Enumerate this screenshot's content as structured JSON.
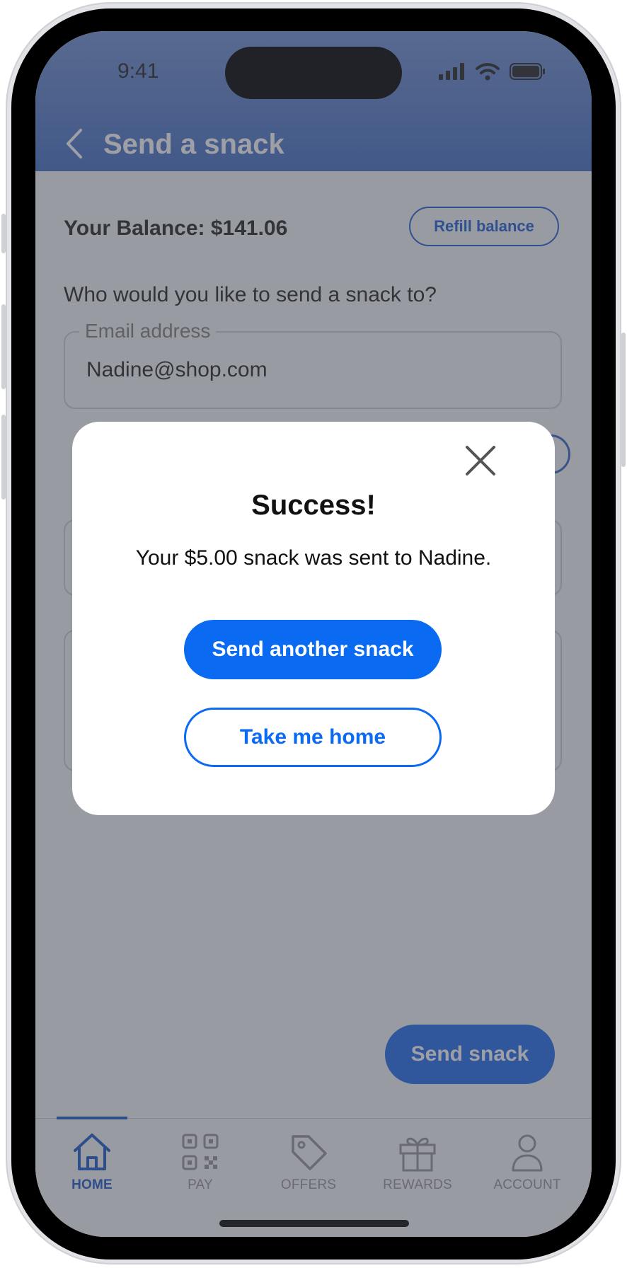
{
  "status_bar": {
    "time": "9:41"
  },
  "header": {
    "title": "Send a snack"
  },
  "balance": {
    "label": "Your Balance: $141.06",
    "refill_label": "Refill balance"
  },
  "form": {
    "question": "Who would you like to send a snack to?",
    "email_label": "Email address",
    "email_value": "Nadine@shop.com"
  },
  "send_button_label": "Send snack",
  "tabs": [
    {
      "label": "HOME",
      "icon": "home-icon",
      "active": true
    },
    {
      "label": "PAY",
      "icon": "qr-code-icon",
      "active": false
    },
    {
      "label": "OFFERS",
      "icon": "tag-icon",
      "active": false
    },
    {
      "label": "REWARDS",
      "icon": "gift-icon",
      "active": false
    },
    {
      "label": "ACCOUNT",
      "icon": "user-icon",
      "active": false
    }
  ],
  "modal": {
    "title": "Success!",
    "message": "Your $5.00 snack was sent to Nadine.",
    "primary_label": "Send another snack",
    "secondary_label": "Take me home"
  },
  "colors": {
    "accent": "#0a6bf2",
    "header": "#4f78c6",
    "overlay": "#343642"
  }
}
